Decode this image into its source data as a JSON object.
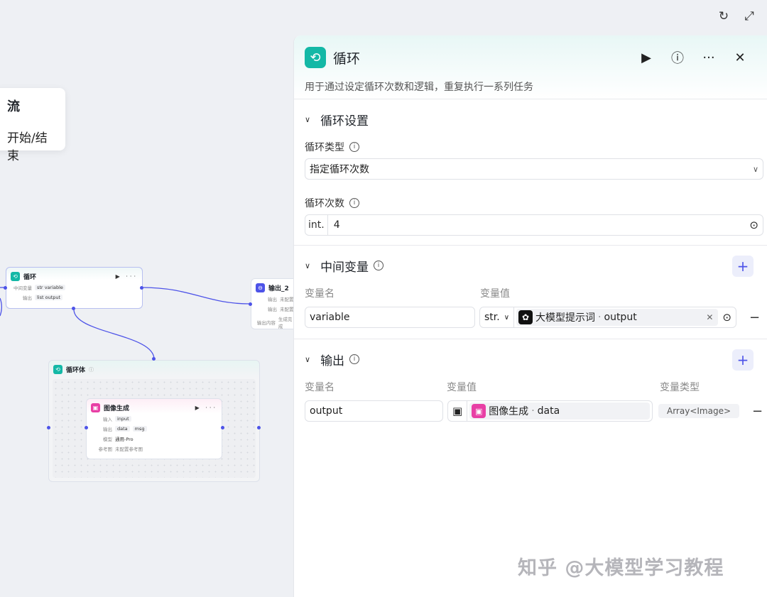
{
  "tooltip": {
    "line1": "流",
    "line2": "开始/结束"
  },
  "canvas_nodes": {
    "loop": {
      "title": "循环",
      "rows": [
        {
          "label": "中间变量",
          "chip": "variable",
          "tag": "str"
        },
        {
          "label": "输出",
          "chip": "output",
          "tag": "list"
        }
      ]
    },
    "output2": {
      "title": "输出_2",
      "rows": [
        {
          "label": "输出",
          "value": "未配置"
        },
        {
          "label": "输出",
          "value": "未配置"
        },
        {
          "label": "输出内容",
          "value": "生成完成"
        }
      ]
    },
    "loop_body": {
      "title": "循环体"
    },
    "image_gen": {
      "title": "图像生成",
      "rows": [
        {
          "label": "输入",
          "chips": [
            "input"
          ]
        },
        {
          "label": "输出",
          "chips": [
            "data",
            "msg"
          ]
        },
        {
          "label": "模型",
          "chips": [
            "通用-Pro"
          ]
        },
        {
          "label": "参考图",
          "chips": [
            "未配置参考图"
          ]
        }
      ]
    }
  },
  "panel": {
    "title": "循环",
    "description": "用于通过设定循环次数和逻辑，重复执行一系列任务",
    "loop_settings": {
      "section_title": "循环设置",
      "type_label": "循环类型",
      "type_value": "指定循环次数",
      "count_label": "循环次数",
      "count_type": "int.",
      "count_value": "4"
    },
    "intermediate": {
      "section_title": "中间变量",
      "col_name": "变量名",
      "col_value": "变量值",
      "row": {
        "name": "variable",
        "type": "str.",
        "ref_source": "大模型提示词",
        "ref_field": "output"
      }
    },
    "output": {
      "section_title": "输出",
      "col_name": "变量名",
      "col_value": "变量值",
      "col_type": "变量类型",
      "row": {
        "name": "output",
        "ref_source": "图像生成",
        "ref_field": "data",
        "var_type": "Array<Image>"
      }
    }
  },
  "watermark": "知乎 @大模型学习教程",
  "colors": {
    "accent": "#4d53e8",
    "loop_teal": "#14b8a6",
    "image_pink": "#e83fa5"
  }
}
